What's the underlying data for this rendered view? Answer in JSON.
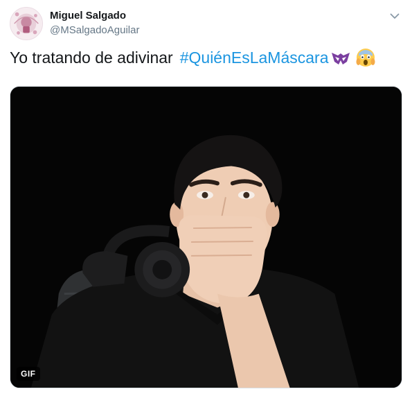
{
  "author": {
    "name": "Miguel Salgado",
    "handle": "@MSalgadoAguilar"
  },
  "tweet": {
    "text": "Yo tratando de adivinar",
    "hashtag": "#QuiénEsLaMáscara",
    "emojis": [
      "purple-mask-icon",
      "face-screaming-in-fear-icon"
    ]
  },
  "media": {
    "badge": "GIF",
    "description_icon": "gif-thumbnail"
  },
  "colors": {
    "link": "#1b95e0",
    "text": "#14171a",
    "muted": "#657786",
    "mask": "#7b3fa0"
  },
  "icons": {
    "menu": "chevron-down-icon"
  }
}
